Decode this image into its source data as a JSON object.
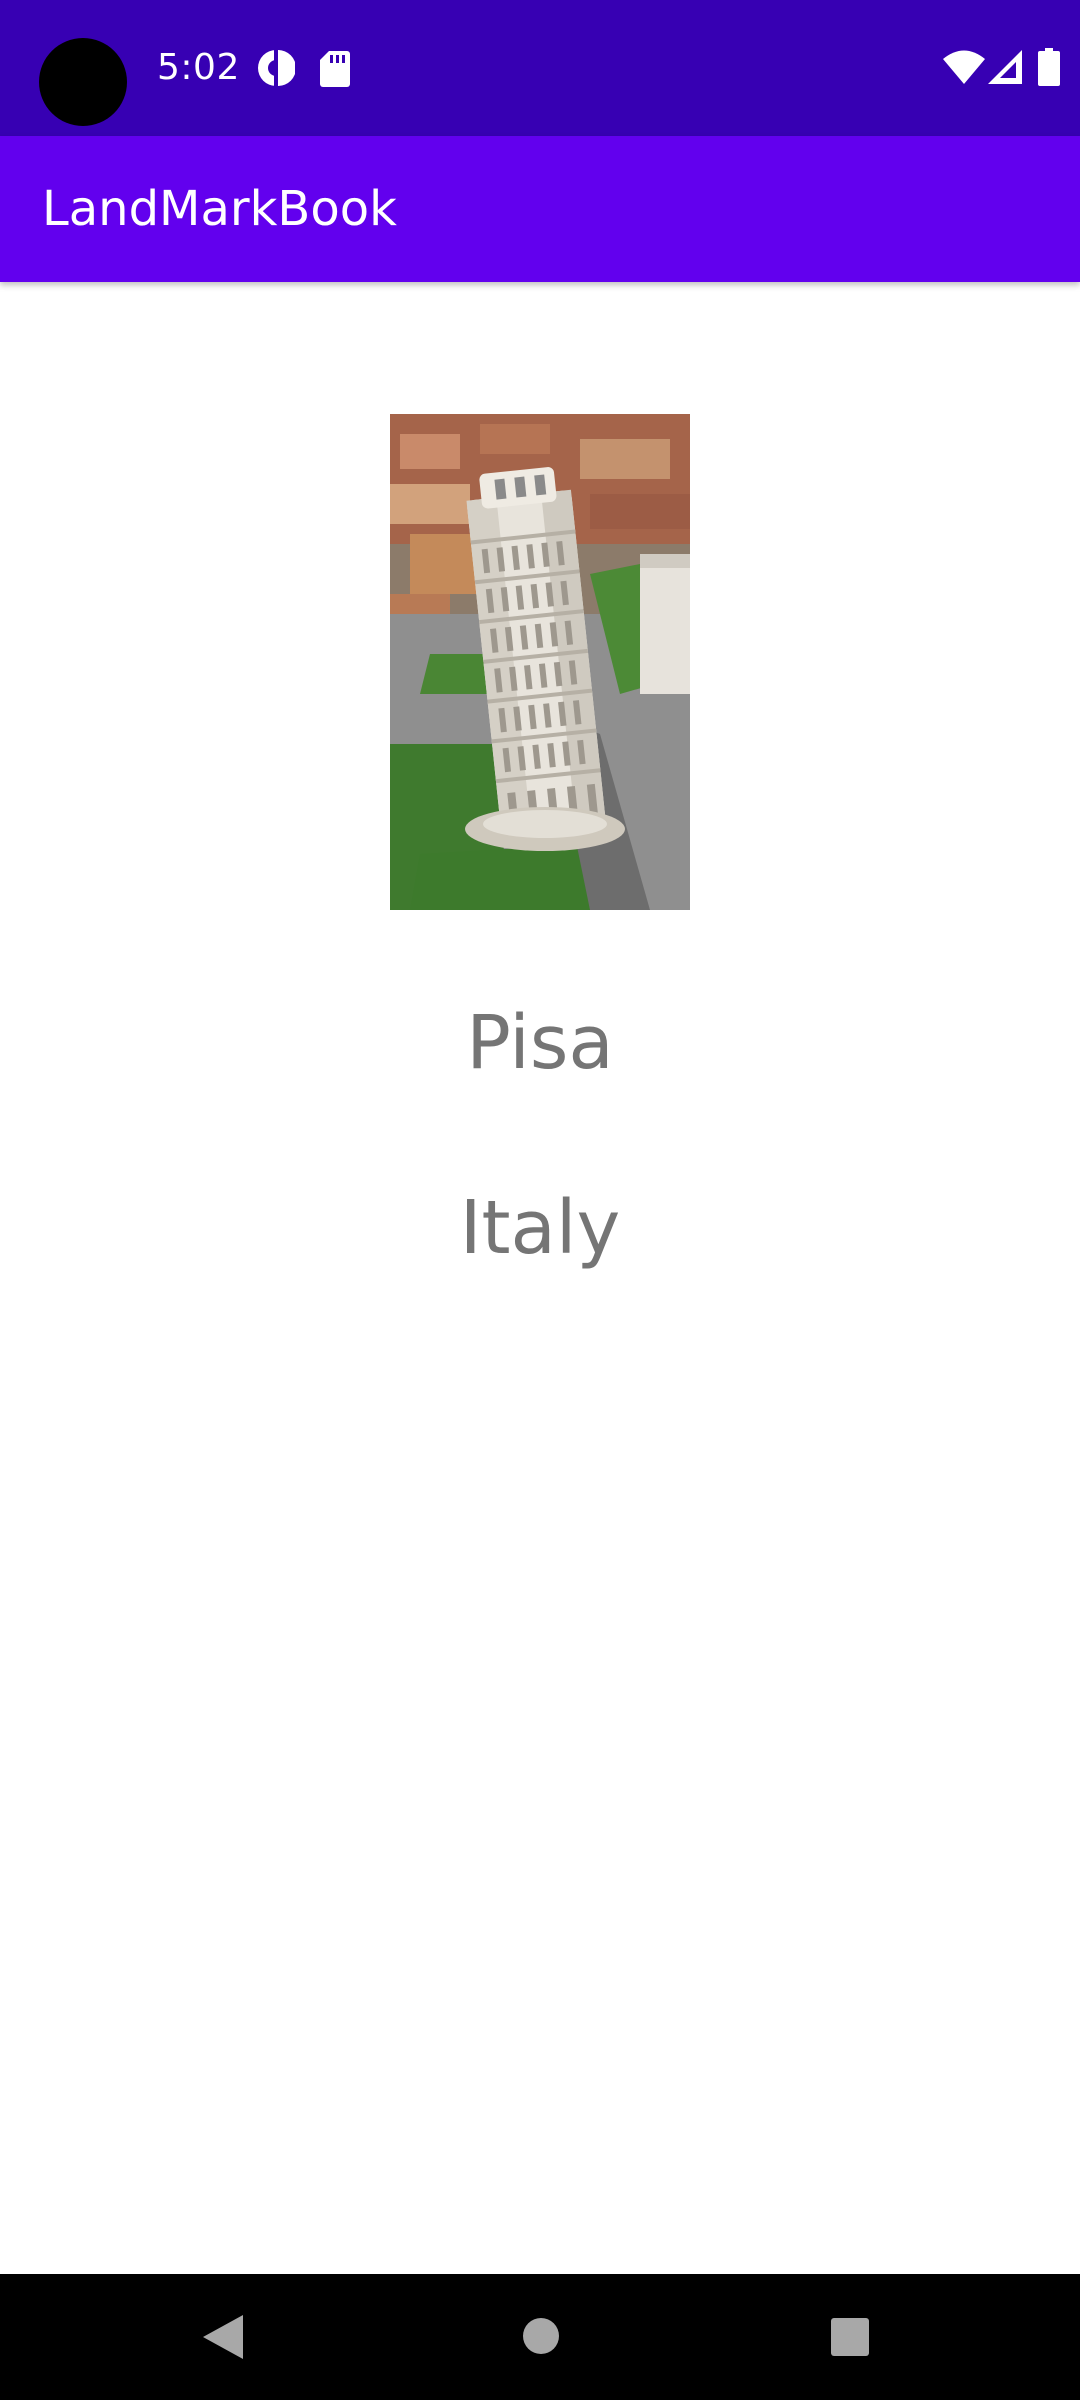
{
  "status_bar": {
    "time": "5:02",
    "icons": [
      "data-saver-icon",
      "sd-card-icon",
      "wifi-icon",
      "cell-signal-icon",
      "battery-icon"
    ]
  },
  "app_bar": {
    "title": "LandMarkBook"
  },
  "landmark": {
    "image": "leaning-tower-photo",
    "name": "Pisa",
    "country": "Italy"
  },
  "nav_bar": {
    "buttons": [
      "back-icon",
      "home-icon",
      "recents-icon"
    ]
  },
  "colors": {
    "status_bar": "#3700b3",
    "app_bar": "#6200ee",
    "text_secondary": "#757575"
  }
}
